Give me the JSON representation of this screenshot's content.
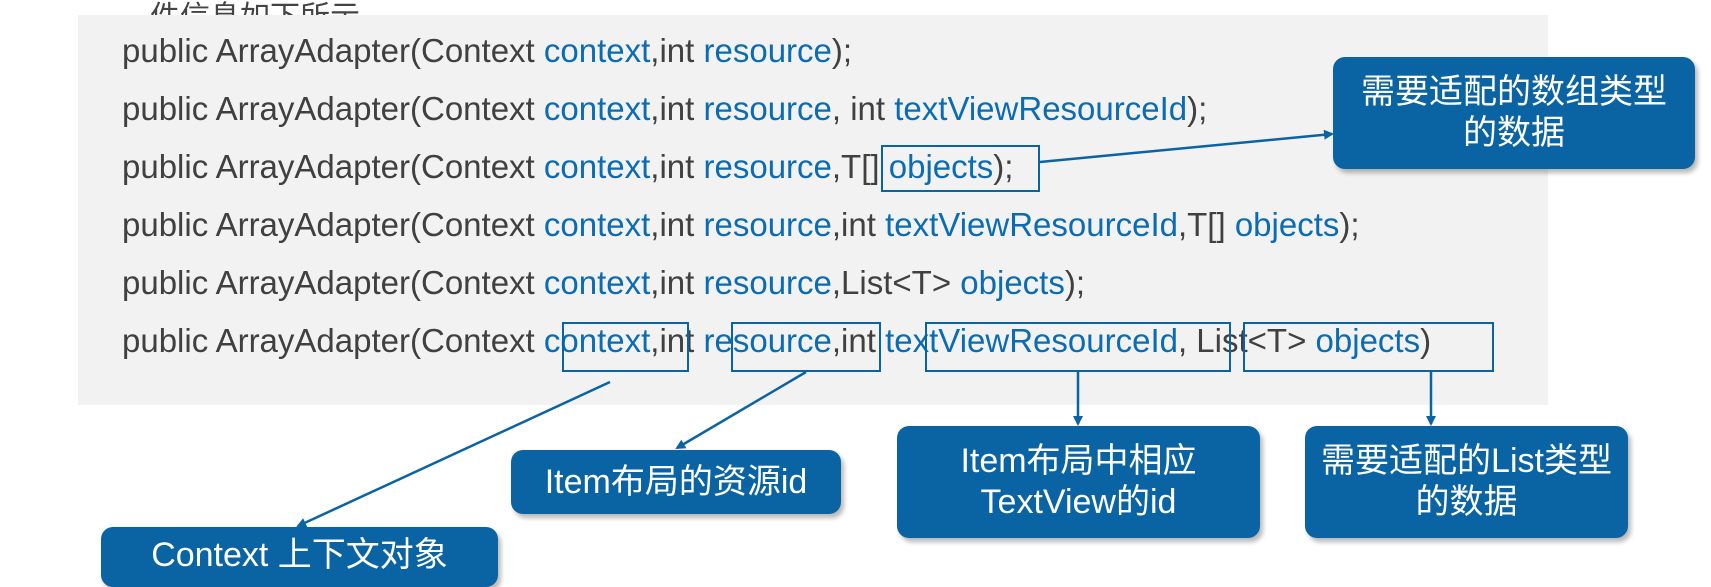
{
  "header_fragment": "件信息如下所示",
  "code_lines": [
    [
      {
        "t": "public ArrayAdapter(Context ",
        "k": "n"
      },
      {
        "t": "context",
        "k": "p"
      },
      {
        "t": ",int ",
        "k": "n"
      },
      {
        "t": "resource",
        "k": "p"
      },
      {
        "t": ");",
        "k": "n"
      }
    ],
    [
      {
        "t": "public ArrayAdapter(Context ",
        "k": "n"
      },
      {
        "t": "context",
        "k": "p"
      },
      {
        "t": ",int ",
        "k": "n"
      },
      {
        "t": "resource",
        "k": "p"
      },
      {
        "t": ", int ",
        "k": "n"
      },
      {
        "t": "textViewResourceId",
        "k": "p"
      },
      {
        "t": ");",
        "k": "n"
      }
    ],
    [
      {
        "t": "public ArrayAdapter(Context ",
        "k": "n"
      },
      {
        "t": "context",
        "k": "p"
      },
      {
        "t": ",int ",
        "k": "n"
      },
      {
        "t": "resource",
        "k": "p"
      },
      {
        "t": ",T[] ",
        "k": "n"
      },
      {
        "t": "objects",
        "k": "p"
      },
      {
        "t": ");",
        "k": "n"
      }
    ],
    [
      {
        "t": "public ArrayAdapter(Context ",
        "k": "n"
      },
      {
        "t": "context",
        "k": "p"
      },
      {
        "t": ",int ",
        "k": "n"
      },
      {
        "t": "resource",
        "k": "p"
      },
      {
        "t": ",int ",
        "k": "n"
      },
      {
        "t": "textViewResourceId",
        "k": "p"
      },
      {
        "t": ",T[] ",
        "k": "n"
      },
      {
        "t": "objects",
        "k": "p"
      },
      {
        "t": ");",
        "k": "n"
      }
    ],
    [
      {
        "t": "public ArrayAdapter(Context ",
        "k": "n"
      },
      {
        "t": "context",
        "k": "p"
      },
      {
        "t": ",int ",
        "k": "n"
      },
      {
        "t": "resource",
        "k": "p"
      },
      {
        "t": ",List<T> ",
        "k": "n"
      },
      {
        "t": "objects",
        "k": "p"
      },
      {
        "t": ");",
        "k": "n"
      }
    ],
    [
      {
        "t": "public ArrayAdapter(Context ",
        "k": "n"
      },
      {
        "t": "context",
        "k": "p"
      },
      {
        "t": ",int ",
        "k": "n"
      },
      {
        "t": "resource",
        "k": "p"
      },
      {
        "t": ",int ",
        "k": "n"
      },
      {
        "t": "textViewResourceId",
        "k": "p"
      },
      {
        "t": ", List<T> ",
        "k": "n"
      },
      {
        "t": "objects",
        "k": "p"
      },
      {
        "t": ")",
        "k": "n"
      }
    ]
  ],
  "callouts": {
    "array_objects": "需要适配的数组类型的数据",
    "resource": "Item布局的资源id",
    "textview_id": "Item布局中相应TextView的id",
    "list_objects": "需要适配的List类型的数据",
    "context": "Context 上下文对象"
  },
  "colors": {
    "param_blue": "#0b6cb3",
    "callout_blue": "#0a63a3",
    "panel_gray": "#f2f2f2",
    "code_text": "#404040"
  }
}
